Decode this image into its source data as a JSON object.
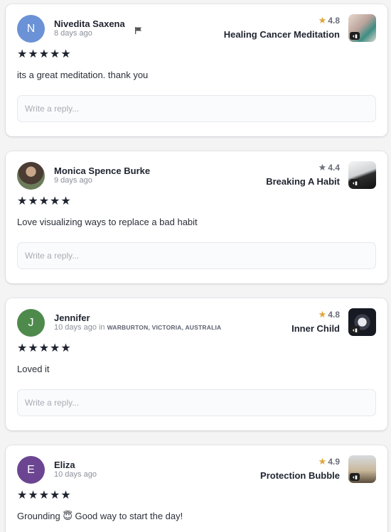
{
  "reviews": [
    {
      "avatar_letter": "N",
      "avatar_color": "#6b92d6",
      "name": "Nivedita Saxena",
      "time": "8 days ago",
      "location": "",
      "rating": "4.8",
      "course": "Healing Cancer Meditation",
      "stars": "★★★★★",
      "text": "its a great meditation. thank you",
      "reply_placeholder": "Write a reply..."
    },
    {
      "avatar_letter": "",
      "avatar_color": "",
      "name": "Monica Spence Burke",
      "time": "9 days ago",
      "location": "",
      "rating": "4.4",
      "course": "Breaking A Habit",
      "stars": "★★★★★",
      "text": "Love visualizing ways to replace a bad habit",
      "reply_placeholder": "Write a reply..."
    },
    {
      "avatar_letter": "J",
      "avatar_color": "#4e8a4c",
      "name": "Jennifer",
      "time": "10 days ago in",
      "location": "WARBURTON, VICTORIA, AUSTRALIA",
      "rating": "4.8",
      "course": "Inner Child",
      "stars": "★★★★★",
      "text": "Loved it",
      "reply_placeholder": "Write a reply..."
    },
    {
      "avatar_letter": "E",
      "avatar_color": "#6c4592",
      "name": "Eliza",
      "time": "10 days ago",
      "location": "",
      "rating": "4.9",
      "course": "Protection Bubble",
      "stars": "★★★★★",
      "text": "Grounding 😇 Good way to start the day!",
      "reply_placeholder": "Write a reply..."
    }
  ],
  "colors": {
    "gold_star": "#e0a63a",
    "gray_star": "#6b6f78",
    "text_dark": "#1f2430"
  },
  "icons": {
    "flag": "flag-icon",
    "audio_badge": "audio-badge-icon"
  }
}
